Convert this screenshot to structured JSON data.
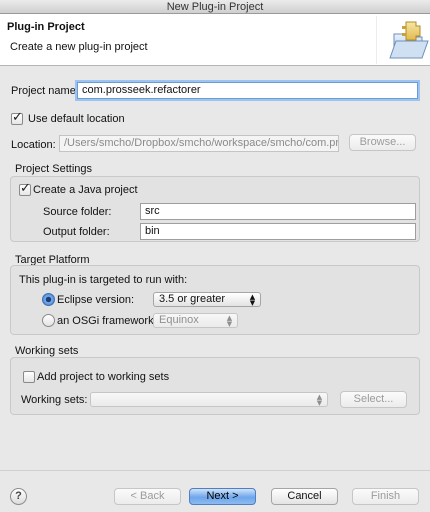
{
  "window": {
    "title": "New Plug-in Project"
  },
  "header": {
    "title": "Plug-in Project",
    "description": "Create a new plug-in project",
    "icon": "folder-plugin-icon"
  },
  "project": {
    "name_label": "Project name:",
    "name_value": "com.prosseek.refactorer",
    "use_default_label": "Use default location",
    "use_default_checked": true,
    "location_label": "Location:",
    "location_value": "/Users/smcho/Dropbox/smcho/workspace/smcho/com.pross",
    "browse_label": "Browse..."
  },
  "project_settings": {
    "title": "Project Settings",
    "java_label": "Create a Java project",
    "java_checked": true,
    "source_label": "Source folder:",
    "source_value": "src",
    "output_label": "Output folder:",
    "output_value": "bin"
  },
  "target_platform": {
    "title": "Target Platform",
    "prompt": "This plug-in is targeted to run with:",
    "eclipse_label": "Eclipse version:",
    "eclipse_selected": true,
    "eclipse_version": "3.5 or greater",
    "osgi_label": "an OSGi framework:",
    "osgi_value": "Equinox"
  },
  "working_sets": {
    "title": "Working sets",
    "add_label": "Add project to working sets",
    "add_checked": false,
    "sets_label": "Working sets:",
    "sets_value": "",
    "select_label": "Select..."
  },
  "footer": {
    "help": "?",
    "back": "< Back",
    "next": "Next >",
    "cancel": "Cancel",
    "finish": "Finish"
  }
}
